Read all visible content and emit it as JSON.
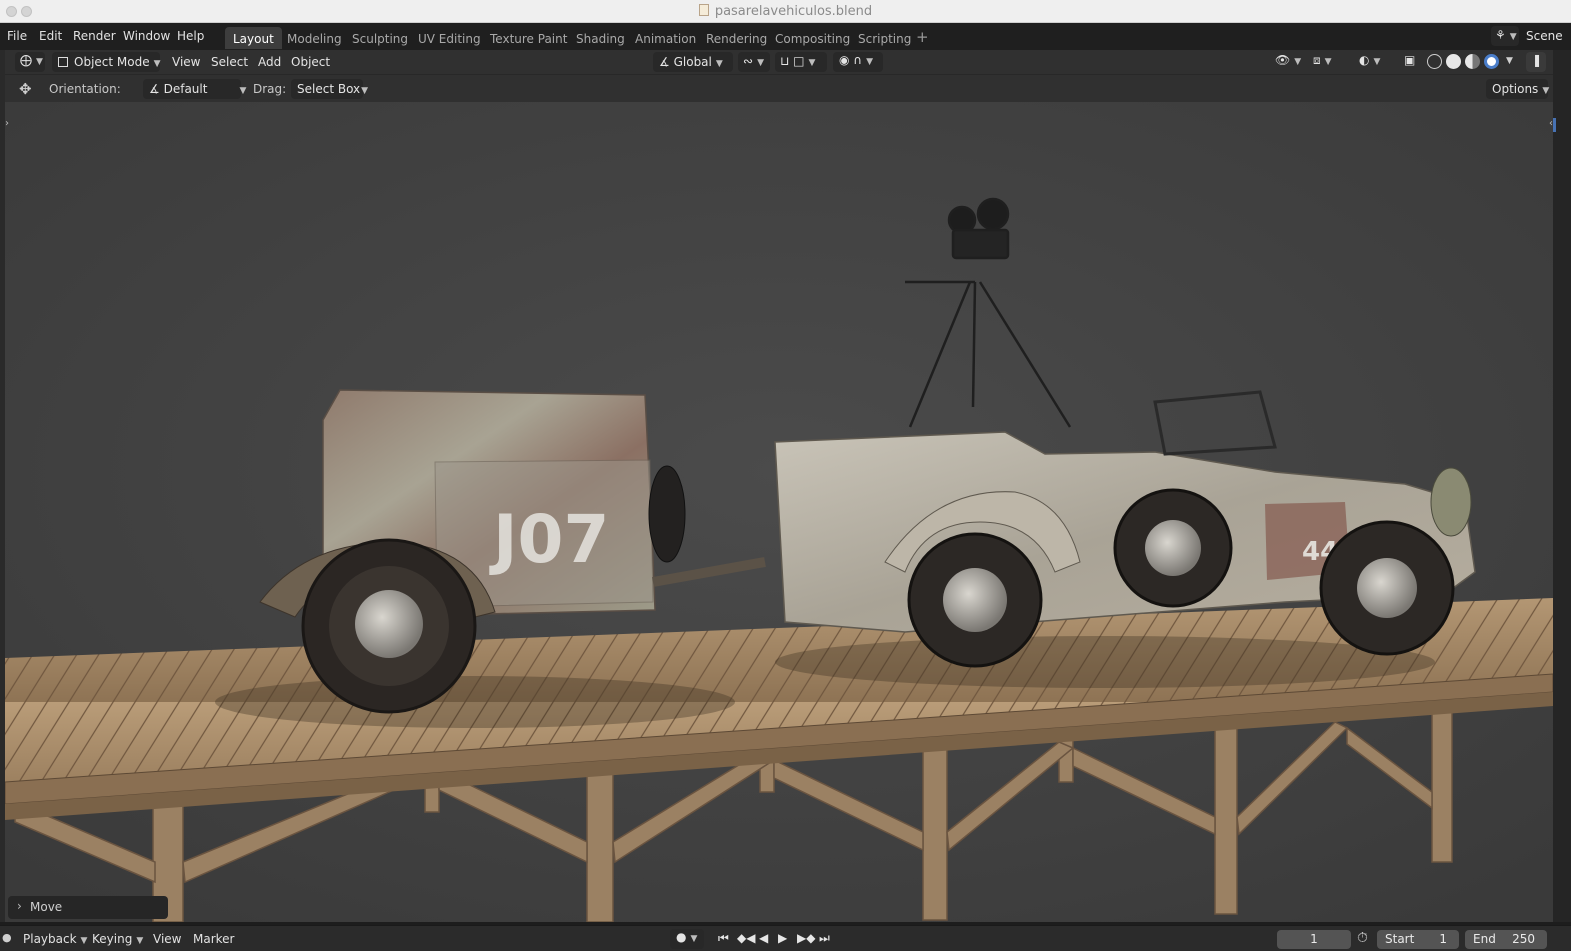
{
  "window": {
    "title": "pasarelavehiculos.blend"
  },
  "menu": [
    "File",
    "Edit",
    "Render",
    "Window",
    "Help"
  ],
  "workspaces": [
    "Layout",
    "Modeling",
    "Sculpting",
    "UV Editing",
    "Texture Paint",
    "Shading",
    "Animation",
    "Rendering",
    "Compositing",
    "Scripting"
  ],
  "active_workspace": "Layout",
  "scene_label": "Scene",
  "viewport_header": {
    "mode": "Object Mode",
    "menus": [
      "View",
      "Select",
      "Add",
      "Object"
    ],
    "transform_orientation": "Global"
  },
  "tool_settings": {
    "orientation_label": "Orientation:",
    "orientation_value": "Default",
    "drag_label": "Drag:",
    "drag_value": "Select Box",
    "options": "Options"
  },
  "last_operator": "Move",
  "timeline": {
    "menus": [
      "Playback",
      "Keying",
      "View",
      "Marker"
    ],
    "current_frame": "1",
    "start_label": "Start",
    "start": "1",
    "end_label": "End",
    "end": "250"
  },
  "scene_text": {
    "trailer_number": "J07",
    "car_number": "44"
  },
  "icons": [
    "object-mode-icon",
    "move-tool-icon",
    "orientation-icon",
    "transform-pivot-icon",
    "snap-icon",
    "proportional-edit-icon",
    "visibility-icon",
    "gizmo-icon",
    "overlay-icon",
    "xray-icon",
    "shading-wireframe-icon",
    "shading-solid-icon",
    "shading-material-icon",
    "shading-rendered-icon",
    "record-icon",
    "jump-start-icon",
    "prev-keyframe-icon",
    "play-reverse-icon",
    "play-icon",
    "next-keyframe-icon",
    "jump-end-icon",
    "stopwatch-icon"
  ]
}
